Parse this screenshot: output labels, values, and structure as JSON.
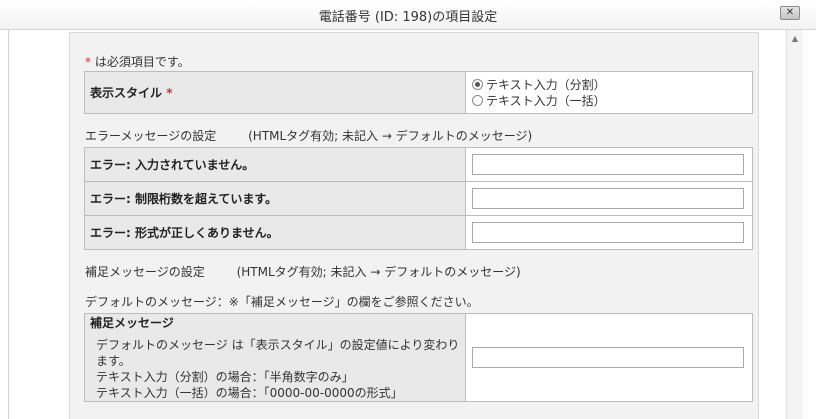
{
  "dialog": {
    "title": "電話番号 (ID: 198)の項目設定",
    "close_label": "✕"
  },
  "scrollbar": {
    "up_arrow": "▲"
  },
  "form": {
    "required_mark": "*",
    "required_note": "は必須項目です。",
    "display_style": {
      "label": "表示スタイル",
      "options": [
        {
          "label": "テキスト入力（分割）",
          "selected": true
        },
        {
          "label": "テキスト入力（一括）",
          "selected": false
        }
      ]
    },
    "error_section": {
      "title": "エラーメッセージの設定",
      "note": "(HTMLタグ有効; 未記入 → デフォルトのメッセージ)",
      "rows": [
        {
          "label": "エラー: 入力されていません。",
          "value": ""
        },
        {
          "label": "エラー: 制限桁数を超えています。",
          "value": ""
        },
        {
          "label": "エラー: 形式が正しくありません。",
          "value": ""
        }
      ]
    },
    "supplement_section": {
      "title": "補足メッセージの設定",
      "note": "(HTMLタグ有効; 未記入 → デフォルトのメッセージ)",
      "default_note": "デフォルトのメッセージ：※「補足メッセージ」の欄をご参照ください。",
      "field_label": "補足メッセージ",
      "description_lines": [
        "デフォルトのメッセージ は「表示スタイル」の設定値により変わります。",
        "テキスト入力（分割）の場合：「半角数字のみ」",
        "テキスト入力（一括）の場合：「0000-00-0000の形式」"
      ],
      "value": ""
    }
  }
}
